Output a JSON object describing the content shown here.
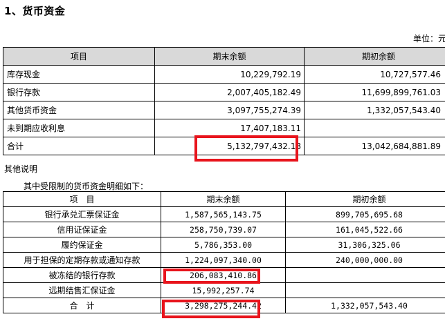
{
  "heading": "1、货币资金",
  "unit": "单位：元",
  "table1": {
    "headers": [
      "项目",
      "期末余额",
      "期初余额"
    ],
    "rows": [
      {
        "item": "库存现金",
        "end": "10,229,792.19",
        "begin": "10,727,577.46"
      },
      {
        "item": "银行存款",
        "end": "2,007,405,182.49",
        "begin": "11,699,899,761.03"
      },
      {
        "item": "其他货币资金",
        "end": "3,097,755,274.39",
        "begin": "1,332,057,543.40"
      },
      {
        "item": "未到期应收利息",
        "end": "17,407,183.11",
        "begin": ""
      },
      {
        "item": "合计",
        "end": "5,132,797,432.18",
        "begin": "13,042,684,881.89"
      }
    ]
  },
  "note": "其他说明",
  "subnote": "其中受限制的货币资金明细如下：",
  "table2": {
    "headers": [
      "项　目",
      "期末余额",
      "期初余额"
    ],
    "rows": [
      {
        "item": "银行承兑汇票保证金",
        "end": "1,587,565,143.75",
        "begin": "899,705,695.68"
      },
      {
        "item": "信用证保证金",
        "end": "258,750,739.07",
        "begin": "161,045,522.66"
      },
      {
        "item": "履约保证金",
        "end": "5,786,353.00",
        "begin": "31,306,325.06"
      },
      {
        "item": "用于担保的定期存款或通知存款",
        "end": "1,224,097,340.00",
        "begin": "240,000,000.00"
      },
      {
        "item": "被冻结的银行存款",
        "end": "206,083,410.86",
        "begin": ""
      },
      {
        "item": "远期结售汇保证金",
        "end": "15,992,257.74",
        "begin": ""
      },
      {
        "item": "合　计",
        "end": "3,298,275,244.42",
        "begin": "1,332,057,543.40"
      }
    ]
  },
  "highlight_color": "#e8141c"
}
